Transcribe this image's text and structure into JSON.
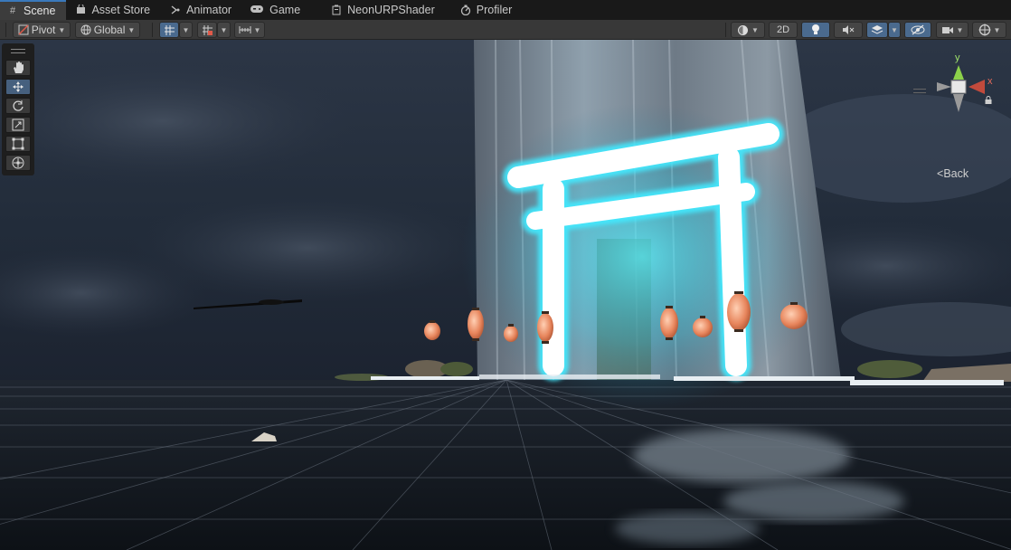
{
  "tabs": [
    {
      "label": "Scene",
      "icon": "grid-icon",
      "active": true
    },
    {
      "label": "Asset Store",
      "icon": "bag-icon"
    },
    {
      "label": "Animator",
      "icon": "animator-icon"
    },
    {
      "label": "Game",
      "icon": "gamepad-icon"
    },
    {
      "label": "NeonURPShader",
      "icon": "shader-icon"
    },
    {
      "label": "Profiler",
      "icon": "profiler-icon"
    }
  ],
  "toolbar": {
    "pivot_label": "Pivot",
    "global_label": "Global",
    "mode_2d_label": "2D"
  },
  "gizmo": {
    "axis_y": "y",
    "axis_x": "x",
    "view_label": "Back"
  },
  "colors": {
    "accent": "#3a79bb",
    "neon": "#38f0ff",
    "lantern": "#e8825a"
  }
}
